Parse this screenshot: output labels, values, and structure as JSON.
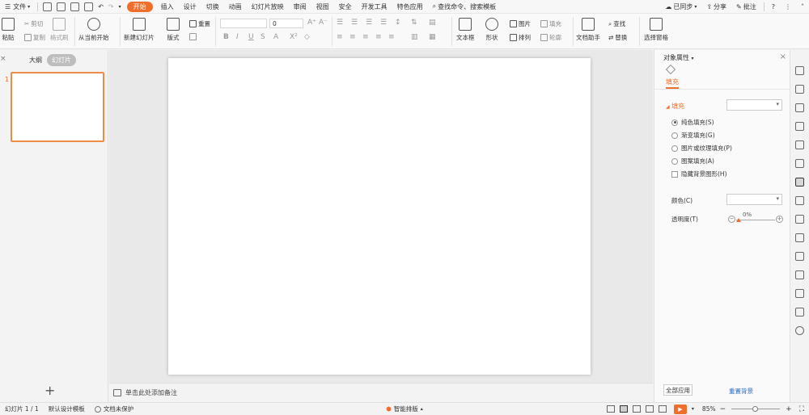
{
  "menubar": {
    "file_label": "文件",
    "tabs": [
      {
        "label": "开始",
        "active": true
      },
      {
        "label": "插入"
      },
      {
        "label": "设计"
      },
      {
        "label": "切换"
      },
      {
        "label": "动画"
      },
      {
        "label": "幻灯片放映"
      },
      {
        "label": "审阅"
      },
      {
        "label": "视图"
      },
      {
        "label": "安全"
      },
      {
        "label": "开发工具"
      },
      {
        "label": "特色应用"
      }
    ],
    "search_label": "查找命令、搜索模板",
    "sync_label": "已同步",
    "share_label": "分享",
    "comment_label": "批注",
    "help_label": "?"
  },
  "ribbon": {
    "paste": "粘贴",
    "cut": "剪切",
    "copy": "复制",
    "format_painter": "格式刷",
    "from_current": "从当前开始",
    "new_slide": "新建幻灯片",
    "layout": "版式",
    "reset": "重置",
    "font_size": "0",
    "textbox": "文本框",
    "shape": "形状",
    "picture": "图片",
    "fill": "填充",
    "arrange": "排列",
    "outline": "轮廓",
    "doc_assistant": "文档助手",
    "find": "查找",
    "replace": "替换",
    "select_pane": "选择窗格"
  },
  "leftpanel": {
    "tab_outline": "大纲",
    "tab_slides": "幻灯片",
    "slide_number": "1",
    "add": "+"
  },
  "notes": {
    "placeholder": "单击此处添加备注"
  },
  "rightpanel": {
    "title": "对象属性",
    "tab_fill": "填充",
    "section_fill": "填充",
    "options": [
      {
        "label": "纯色填充(S)",
        "type": "radio",
        "checked": true
      },
      {
        "label": "渐变填充(G)",
        "type": "radio",
        "checked": false
      },
      {
        "label": "图片或纹理填充(P)",
        "type": "radio",
        "checked": false
      },
      {
        "label": "图案填充(A)",
        "type": "radio",
        "checked": false
      },
      {
        "label": "隐藏背景图形(H)",
        "type": "checkbox",
        "checked": false
      }
    ],
    "color_label": "颜色(C)",
    "transparency_label": "透明度(T)",
    "transparency_value": "0%",
    "apply_all": "全部应用",
    "reset_bg": "重置背景"
  },
  "statusbar": {
    "slide_info": "幻灯片 1 / 1",
    "template": "默认设计模板",
    "protection": "文档未保护",
    "smart_layout": "智能排版",
    "zoom": "85%"
  }
}
